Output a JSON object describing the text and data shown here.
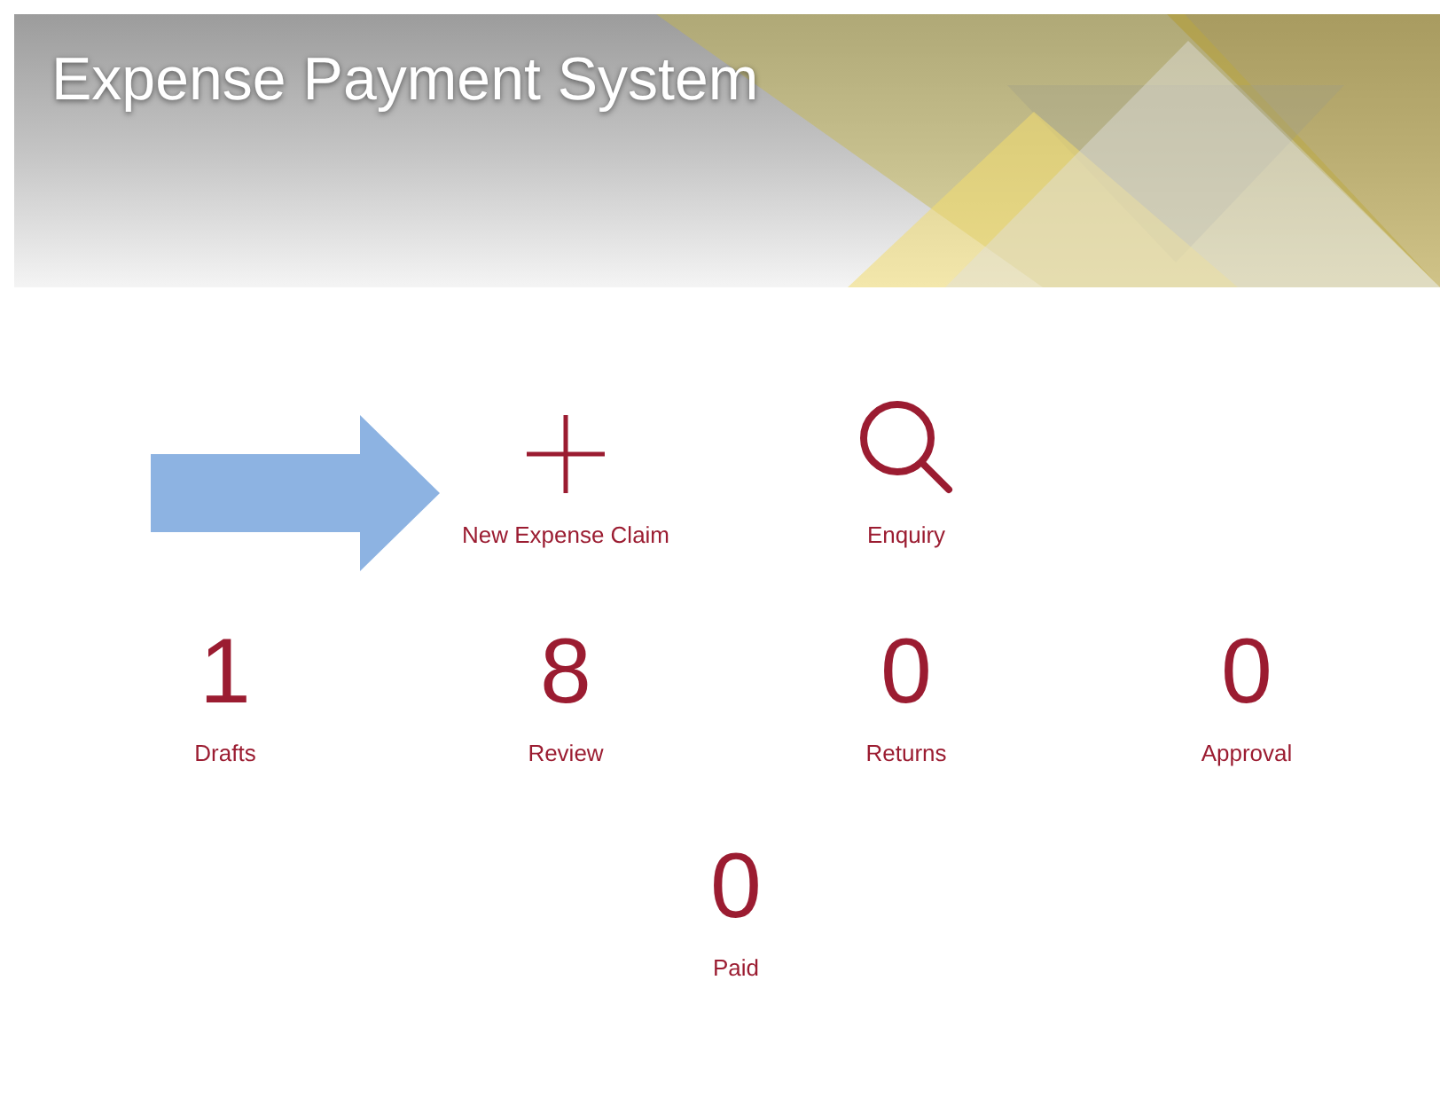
{
  "header": {
    "title": "Expense Payment System"
  },
  "actions": [
    {
      "kind": "plus",
      "label": "New Expense Claim"
    },
    {
      "kind": "search",
      "label": "Enquiry"
    }
  ],
  "counters": [
    {
      "count": "1",
      "label": "Drafts"
    },
    {
      "count": "8",
      "label": "Review"
    },
    {
      "count": "0",
      "label": "Returns"
    },
    {
      "count": "0",
      "label": "Approval"
    },
    {
      "count": "0",
      "label": "Paid"
    }
  ]
}
